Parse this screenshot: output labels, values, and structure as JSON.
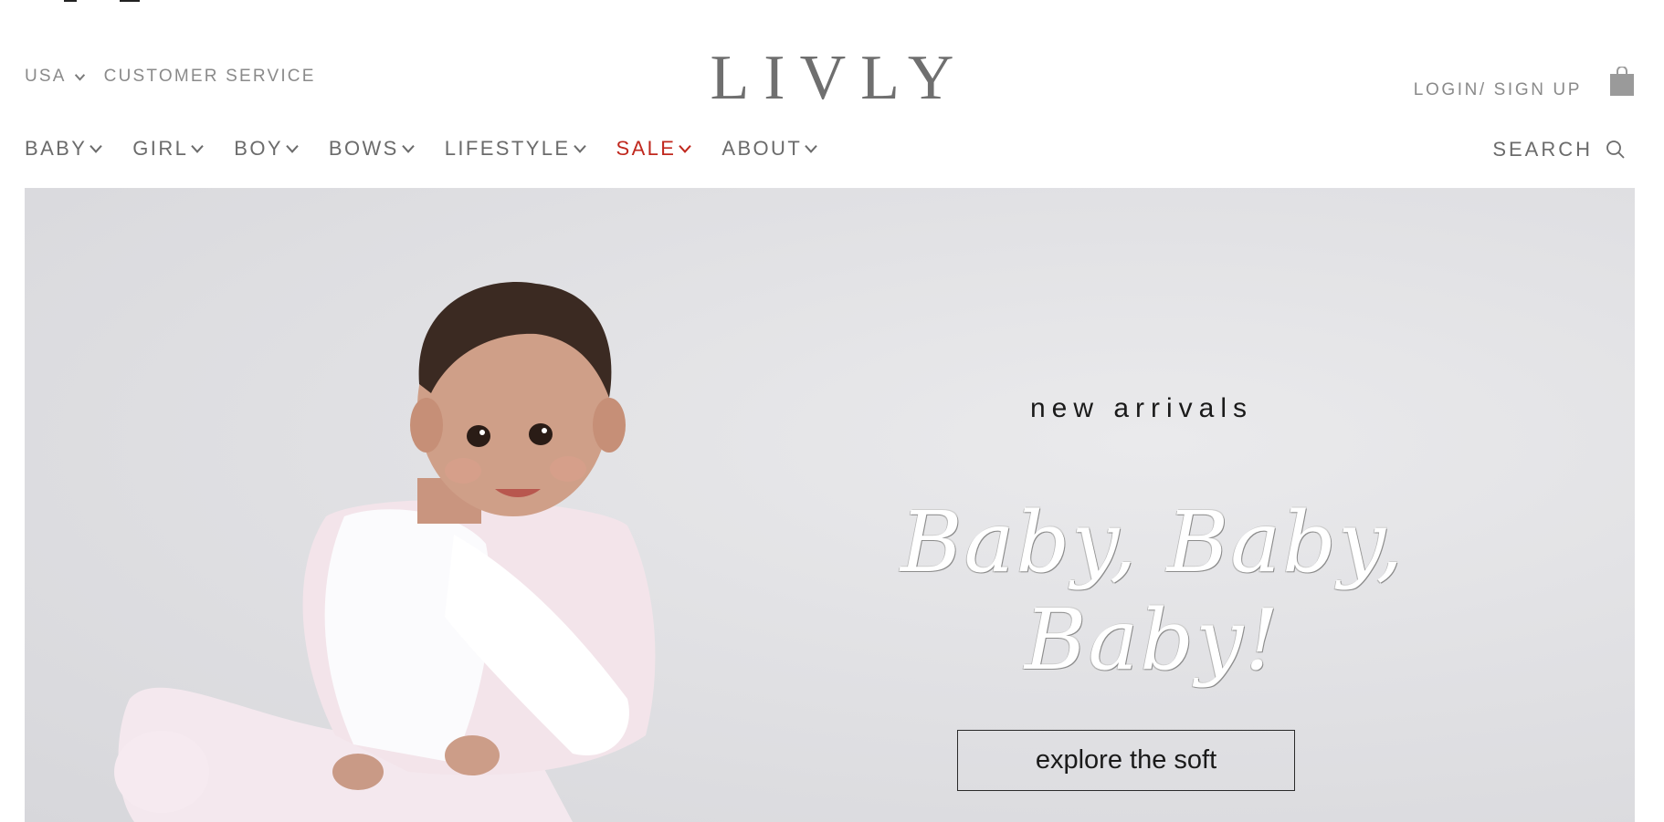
{
  "header": {
    "country": "USA",
    "customer_service": "CUSTOMER SERVICE",
    "logo": "LIVLY",
    "account": "LOGIN/ SIGN UP",
    "search_label": "SEARCH"
  },
  "nav": {
    "items": [
      {
        "label": "BABY"
      },
      {
        "label": "GIRL"
      },
      {
        "label": "BOY"
      },
      {
        "label": "BOWS"
      },
      {
        "label": "LIFESTYLE"
      },
      {
        "label": "SALE"
      },
      {
        "label": "ABOUT"
      }
    ]
  },
  "hero": {
    "eyebrow": "new arrivals",
    "headline": "Baby, Baby, Baby!",
    "cta": "explore the soft"
  },
  "colors": {
    "text_gray": "#6b6b6b",
    "sale_red": "#c0281e",
    "hero_background": "#dcdcdf",
    "headline": "#ffffff"
  },
  "icons": {
    "country_dropdown": "chevron-down-icon",
    "nav_dropdown": "chevron-down-icon",
    "bag": "shopping-bag-icon",
    "search": "search-icon"
  }
}
